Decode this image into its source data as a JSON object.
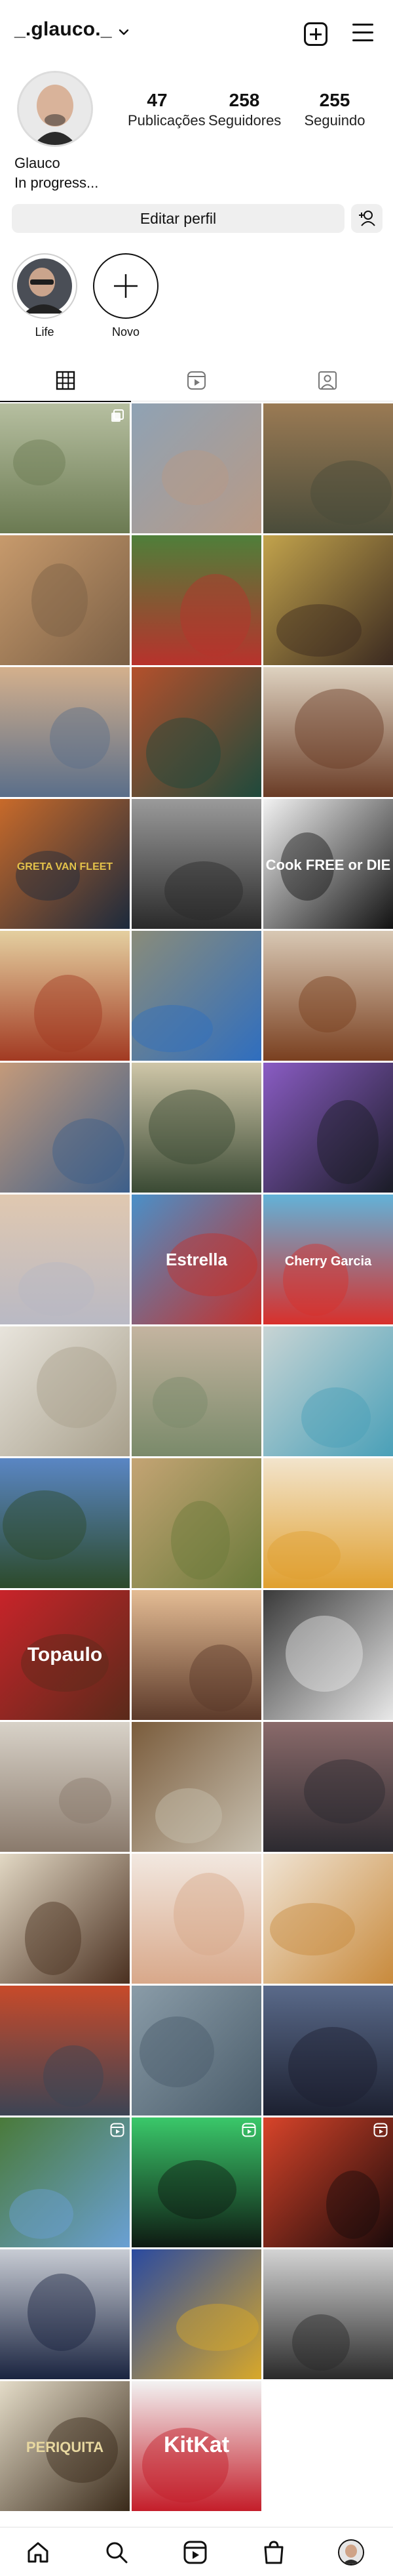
{
  "header": {
    "username": "_.glauco._",
    "icons": [
      "chevron-down-icon",
      "new-post-icon",
      "menu-icon"
    ]
  },
  "profile": {
    "stats": [
      {
        "value": "47",
        "label": "Publicações"
      },
      {
        "value": "258",
        "label": "Seguidores"
      },
      {
        "value": "255",
        "label": "Seguindo"
      }
    ],
    "name": "Glauco",
    "bio": "In progress...",
    "edit_label": "Editar perfil"
  },
  "highlights": [
    {
      "label": "Life"
    },
    {
      "label": "Novo"
    }
  ],
  "tabs": [
    "grid-icon",
    "reels-icon",
    "tagged-icon"
  ],
  "posts": [
    {
      "name": "post-trees-park",
      "color": "#6b7a52",
      "color2": "#b6bfa0",
      "badge": "multi"
    },
    {
      "name": "post-selfie-city",
      "color": "#b89a86",
      "color2": "#8fa2b4",
      "badge": ""
    },
    {
      "name": "post-cat",
      "color": "#4a4c3a",
      "color2": "#9a7a54",
      "badge": ""
    },
    {
      "name": "post-selfie-glasses",
      "color": "#7a5f45",
      "color2": "#c79a6c",
      "badge": ""
    },
    {
      "name": "post-torii-gate",
      "color": "#b8322c",
      "color2": "#4f7f3a",
      "badge": ""
    },
    {
      "name": "post-ramen-bowl",
      "color": "#3b2a20",
      "color2": "#c2a34c",
      "badge": ""
    },
    {
      "name": "post-selfie-sunglasses",
      "color": "#5a6e8a",
      "color2": "#d4b08c",
      "badge": ""
    },
    {
      "name": "post-starbucks-cup",
      "color": "#1f4a3c",
      "color2": "#b4502c",
      "badge": ""
    },
    {
      "name": "post-wine-bottles",
      "color": "#6a3c26",
      "color2": "#ded2c0",
      "badge": ""
    },
    {
      "name": "post-greta-van-fleet",
      "color": "#1c2a3c",
      "color2": "#c86a2a",
      "badge": ""
    },
    {
      "name": "post-selfie-bw",
      "color": "#2a2a2a",
      "color2": "#9a9a9a",
      "badge": ""
    },
    {
      "name": "post-cook-free-or-die",
      "color": "#121212",
      "color2": "#f2f2f2",
      "badge": ""
    },
    {
      "name": "post-bacon-dish",
      "color": "#a23a22",
      "color2": "#e4cfa0",
      "badge": ""
    },
    {
      "name": "post-road-sky",
      "color": "#2f6ebf",
      "color2": "#8a8c7a",
      "badge": ""
    },
    {
      "name": "post-whisky-glass",
      "color": "#7a4020",
      "color2": "#d8c8b4",
      "badge": ""
    },
    {
      "name": "post-man-back",
      "color": "#3d5f8a",
      "color2": "#c49a7a",
      "badge": ""
    },
    {
      "name": "post-champagne-table",
      "color": "#3a4a34",
      "color2": "#cfc6a8",
      "badge": ""
    },
    {
      "name": "post-motherboard",
      "color": "#1a1c26",
      "color2": "#8a5cc4",
      "badge": ""
    },
    {
      "name": "post-beach-sunset",
      "color": "#b9b9c4",
      "color2": "#e0c8b0",
      "badge": ""
    },
    {
      "name": "post-estrella-beer",
      "color": "#c6302a",
      "color2": "#4a90c8",
      "badge": ""
    },
    {
      "name": "post-ben-jerrys",
      "color": "#d8302c",
      "color2": "#62b2d8",
      "badge": ""
    },
    {
      "name": "post-old-building",
      "color": "#a8a08c",
      "color2": "#e8e4dc",
      "badge": ""
    },
    {
      "name": "post-street-house",
      "color": "#7a8a6a",
      "color2": "#c4b4a0",
      "badge": ""
    },
    {
      "name": "post-blue-sculpture",
      "color": "#4aa0b8",
      "color2": "#c8d4d4",
      "badge": ""
    },
    {
      "name": "post-palm-gazebo",
      "color": "#2c4a2a",
      "color2": "#5a86c4",
      "badge": ""
    },
    {
      "name": "post-dirt-road",
      "color": "#6a7a3a",
      "color2": "#c4a474",
      "badge": ""
    },
    {
      "name": "post-soup-bowls",
      "color": "#e0a030",
      "color2": "#f2e4cc",
      "badge": ""
    },
    {
      "name": "post-nutella-jar",
      "color": "#5a2a1a",
      "color2": "#c8242a",
      "badge": ""
    },
    {
      "name": "post-baby-photo",
      "color": "#5c3a2a",
      "color2": "#e4bc94",
      "badge": ""
    },
    {
      "name": "post-framed-art",
      "color": "#e8e8e8",
      "color2": "#3a3a3a",
      "badge": ""
    },
    {
      "name": "post-glasses-crowd",
      "color": "#8a7a6c",
      "color2": "#d8d2c8",
      "badge": ""
    },
    {
      "name": "post-colonial-house",
      "color": "#c8c0b0",
      "color2": "#7a5c3c",
      "badge": ""
    },
    {
      "name": "post-palm-sunset",
      "color": "#2c2a30",
      "color2": "#8a6a6a",
      "badge": ""
    },
    {
      "name": "post-jack-daniels",
      "color": "#4a3020",
      "color2": "#e2d8c4",
      "badge": ""
    },
    {
      "name": "post-tree-tattoo",
      "color": "#d8a88a",
      "color2": "#f2e8e0",
      "badge": ""
    },
    {
      "name": "post-pie-slice",
      "color": "#c88a3c",
      "color2": "#f0e4d4",
      "badge": ""
    },
    {
      "name": "post-airfield-sunset",
      "color": "#3c4454",
      "color2": "#c84a2a",
      "badge": ""
    },
    {
      "name": "post-helicopter-field",
      "color": "#4a5c6a",
      "color2": "#8a9ca8",
      "badge": ""
    },
    {
      "name": "post-old-palace",
      "color": "#1c2030",
      "color2": "#5a6a8a",
      "badge": ""
    },
    {
      "name": "post-helicopter-grass",
      "color": "#6aa0d4",
      "color2": "#4a7a3a",
      "badge": "reel"
    },
    {
      "name": "post-concert-green",
      "color": "#0e1a12",
      "color2": "#3ac86a",
      "badge": "reel"
    },
    {
      "name": "post-concert-red",
      "color": "#1a0a0a",
      "color2": "#d8442a",
      "badge": "reel"
    },
    {
      "name": "post-gran-turismo",
      "color": "#1a2440",
      "color2": "#c8ccd4",
      "badge": ""
    },
    {
      "name": "post-comic-art",
      "color": "#d8a82a",
      "color2": "#2a4aa0",
      "badge": ""
    },
    {
      "name": "post-tablet-screen",
      "color": "#2a2a2a",
      "color2": "#d4d4d4",
      "badge": ""
    },
    {
      "name": "post-periquita-wine",
      "color": "#3a2a1a",
      "color2": "#e4dcc8",
      "badge": ""
    },
    {
      "name": "post-kitkat",
      "color": "#c41e2a",
      "color2": "#f2f2f2",
      "badge": ""
    }
  ],
  "post_texts": {
    "greta": "GRETA VAN FLEET",
    "cook": "Cook FREE or DIE",
    "estrella": "Estrella",
    "benjerry": "Cherry Garcia",
    "nutella": "Topaulo",
    "periquita": "PERIQUITA",
    "kitkat": "KitKat"
  },
  "bottom_nav": [
    "home-icon",
    "search-icon",
    "reels-icon",
    "shop-icon",
    "profile-avatar"
  ]
}
